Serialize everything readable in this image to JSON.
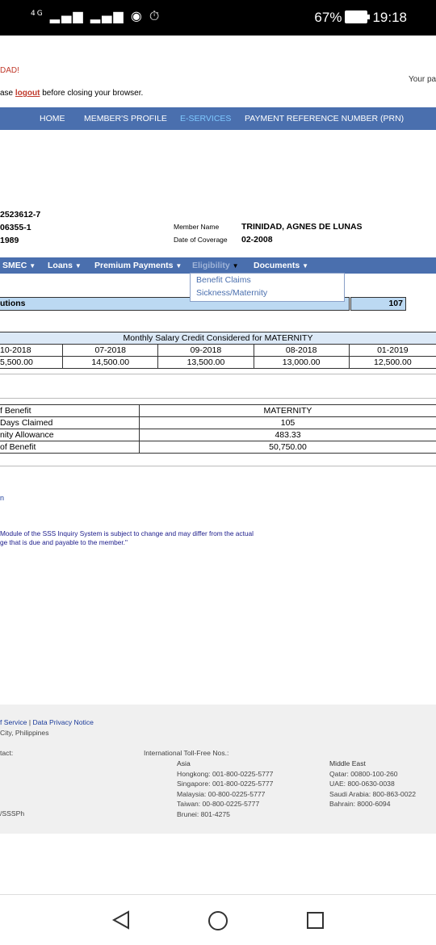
{
  "status_bar": {
    "network": "4G",
    "battery": "67%",
    "time": "19:18"
  },
  "greeting": "DAD!",
  "logout_prefix": "ase ",
  "logout_link": "logout",
  "logout_suffix": " before closing your browser.",
  "your_text": "Your pa",
  "main_nav": {
    "home": "HOME",
    "profile": "MEMBER'S PROFILE",
    "eservices": "E-SERVICES",
    "prn": "PAYMENT REFERENCE NUMBER (PRN)"
  },
  "member": {
    "id_line1": "2523612-7",
    "id_line2": "06355-1",
    "id_line3": "1989",
    "name_label": "Member Name",
    "name_value": "TRINIDAD, AGNES DE LUNAS",
    "coverage_label": "Date of Coverage",
    "coverage_value": "02-2008"
  },
  "sub_menu": {
    "smec": "SMEC",
    "loans": "Loans",
    "premium": "Premium Payments",
    "eligibility": "Eligibility",
    "documents": "Documents"
  },
  "dropdown": {
    "item1": "Benefit Claims",
    "item2": "Sickness/Maternity"
  },
  "contributions": {
    "label": "utions",
    "value": "107"
  },
  "salary_table": {
    "title": "Monthly Salary Credit Considered for MATERNITY",
    "months": [
      "10-2018",
      "07-2018",
      "09-2018",
      "08-2018",
      "01-2019"
    ],
    "amounts": [
      "5,500.00",
      "14,500.00",
      "13,500.00",
      "13,000.00",
      "12,500.00"
    ]
  },
  "benefit_table": {
    "rows": [
      {
        "label": "f Benefit",
        "value": "MATERNITY"
      },
      {
        "label": "Days Claimed",
        "value": "105"
      },
      {
        "label": "nity Allowance",
        "value": "483.33"
      },
      {
        "label": "of Benefit",
        "value": "50,750.00"
      }
    ]
  },
  "n_text": "n",
  "disclaimer": {
    "line1": "Module of the SSS Inquiry System is subject to change and may differ from the actual",
    "line2": "ge that is due and payable to the member.\""
  },
  "footer": {
    "terms": "f Service",
    "sep": " | ",
    "privacy": "Data Privacy Notice",
    "city": " City, Philippines",
    "contact": "tact:",
    "social": "/SSSPh",
    "tollfree_title": "International Toll-Free Nos.:",
    "asia_title": "Asia",
    "asia": [
      "Hongkong: 001-800-0225-5777",
      "Singapore: 001-800-0225-5777",
      "Malaysia: 00-800-0225-5777",
      "Taiwan: 00-800-0225-5777",
      "Brunei: 801-4275"
    ],
    "me_title": "Middle East",
    "me": [
      "Qatar: 00800-100-260",
      "UAE: 800-0630-0038",
      "Saudi Arabia: 800-863-0022",
      "Bahrain: 8000-6094"
    ]
  }
}
